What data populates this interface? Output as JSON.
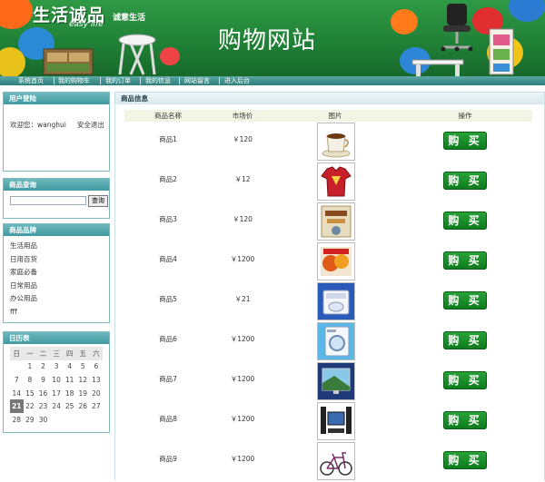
{
  "banner": {
    "logo_main": "生活诚品",
    "logo_sub": "诚意生活",
    "logo_en": "easy life",
    "site_title": "购物网站"
  },
  "nav": {
    "items": [
      "系统首页",
      "我的购物车",
      "我的订单",
      "我的信息",
      "网站留言",
      "进入后台"
    ]
  },
  "login_panel": {
    "title": "用户登陆",
    "welcome": "欢迎您：wanghui",
    "logout": "安全退出"
  },
  "search_panel": {
    "title": "商品查询",
    "input_value": "",
    "button": "查询"
  },
  "category_panel": {
    "title": "商品品牌",
    "items": [
      "生活用品",
      "日用百货",
      "家庭必备",
      "日常用品",
      "办公用品",
      "fff"
    ]
  },
  "calendar_panel": {
    "title": "日历表",
    "weekdays": [
      "日",
      "一",
      "二",
      "三",
      "四",
      "五",
      "六"
    ],
    "weeks": [
      [
        "",
        "1",
        "2",
        "3",
        "4",
        "5",
        "6"
      ],
      [
        "7",
        "8",
        "9",
        "10",
        "11",
        "12",
        "13"
      ],
      [
        "14",
        "15",
        "16",
        "17",
        "18",
        "19",
        "20"
      ],
      [
        "21",
        "22",
        "23",
        "24",
        "25",
        "26",
        "27"
      ],
      [
        "28",
        "29",
        "30",
        "",
        "",
        "",
        ""
      ]
    ],
    "today": "21"
  },
  "main": {
    "title": "商品信息",
    "columns": [
      "商品名称",
      "市场价",
      "图片",
      "操作"
    ],
    "buy_label": "购 买",
    "products": [
      {
        "name": "商品1",
        "price": "￥120",
        "image": "coffee-cup-icon"
      },
      {
        "name": "商品2",
        "price": "￥12",
        "image": "red-shirt-icon"
      },
      {
        "name": "商品3",
        "price": "￥120",
        "image": "book-cover-icon"
      },
      {
        "name": "商品4",
        "price": "￥1200",
        "image": "food-package-icon"
      },
      {
        "name": "商品5",
        "price": "￥21",
        "image": "washing-machine-icon"
      },
      {
        "name": "商品6",
        "price": "￥1200",
        "image": "front-load-washer-icon"
      },
      {
        "name": "商品7",
        "price": "￥1200",
        "image": "flat-tv-icon"
      },
      {
        "name": "商品8",
        "price": "￥1200",
        "image": "home-theater-icon"
      },
      {
        "name": "商品9",
        "price": "￥1200",
        "image": "bicycle-icon"
      }
    ]
  }
}
